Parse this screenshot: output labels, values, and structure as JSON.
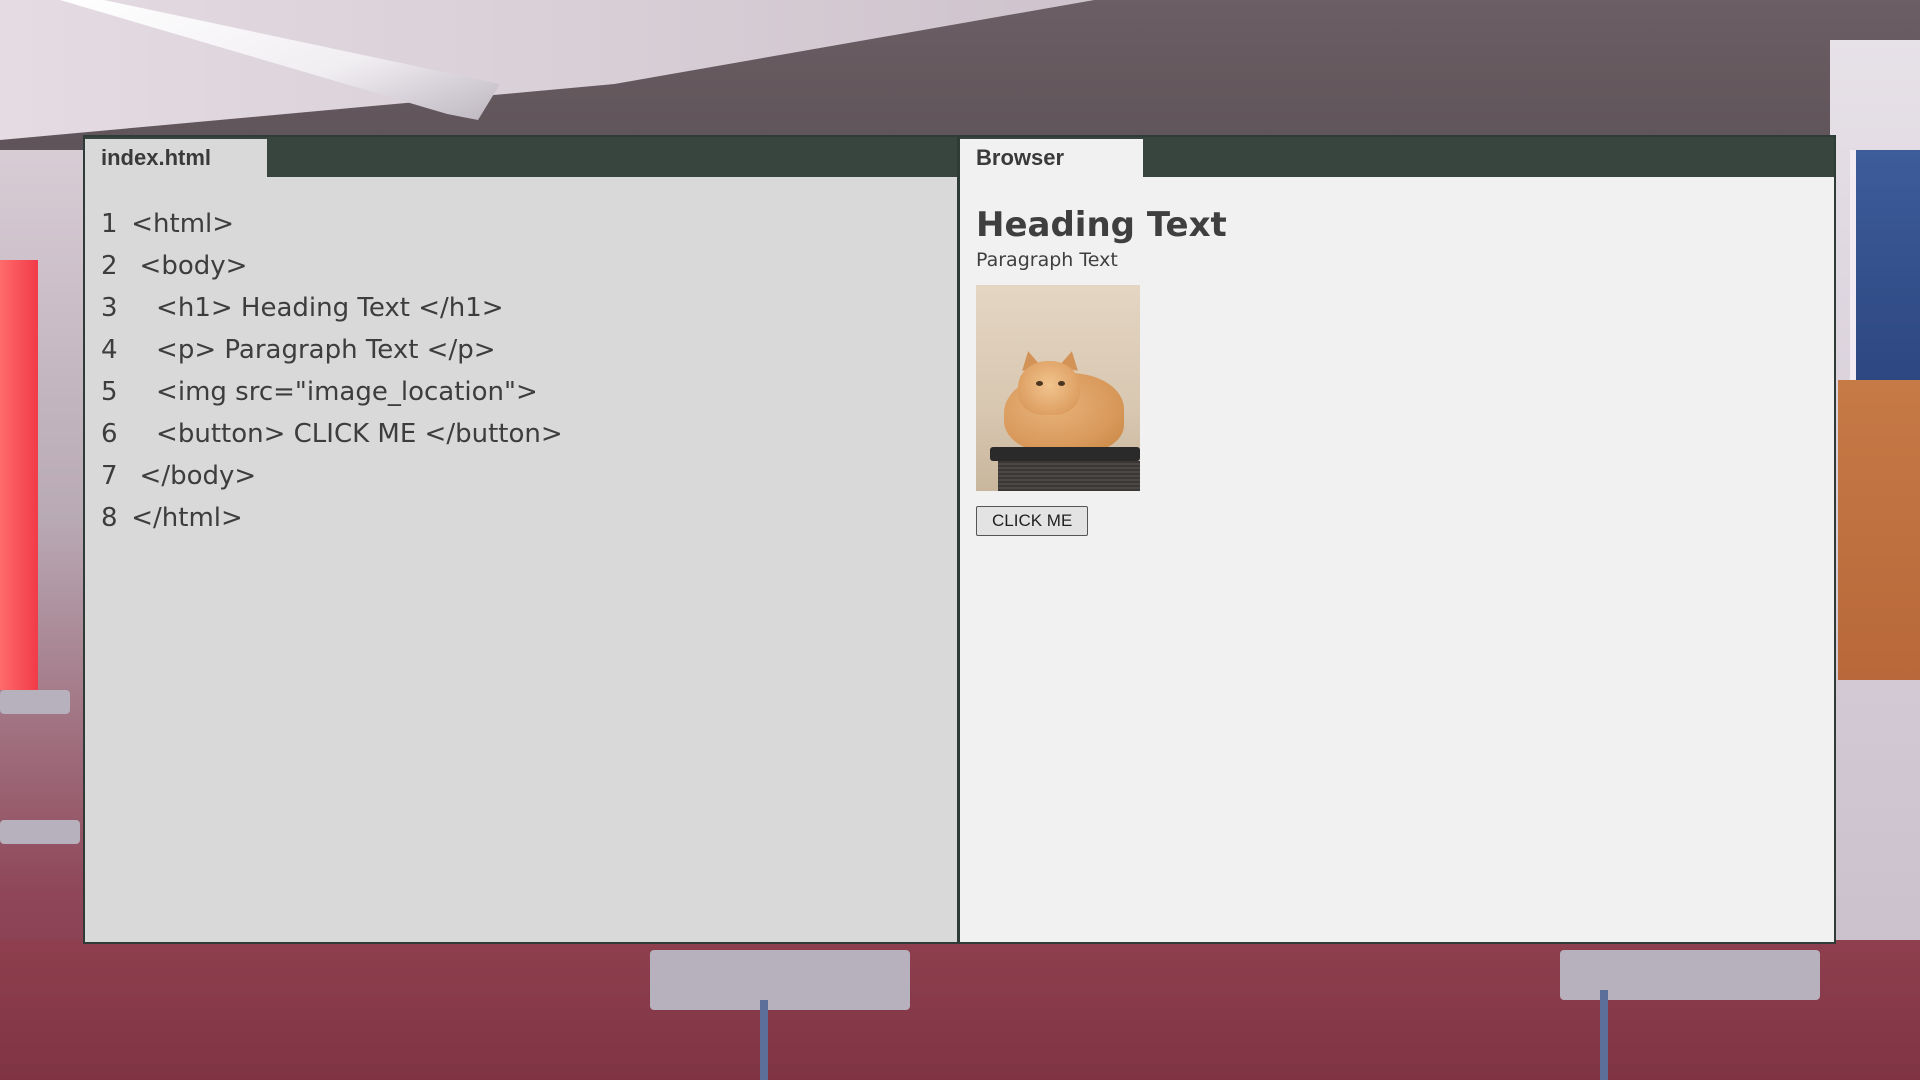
{
  "editor": {
    "tab_label": "index.html",
    "lines": [
      {
        "num": "1",
        "text": " <html>"
      },
      {
        "num": "2",
        "text": "  <body>"
      },
      {
        "num": "3",
        "text": "    <h1> Heading Text </h1>"
      },
      {
        "num": "4",
        "text": "    <p> Paragraph Text </p>"
      },
      {
        "num": "5",
        "text": "    <img src=\"image_location\">"
      },
      {
        "num": "6",
        "text": "    <button> CLICK ME </button>"
      },
      {
        "num": "7",
        "text": "  </body>"
      },
      {
        "num": "8",
        "text": " </html>"
      }
    ]
  },
  "browser": {
    "tab_label": "Browser",
    "heading": "Heading Text",
    "paragraph": "Paragraph Text",
    "image": {
      "icon": "cat-photo"
    },
    "button_label": "CLICK ME"
  },
  "colors": {
    "tabbar": "#38443e",
    "editor_bg": "#d9d9d9",
    "browser_bg": "#f1f1f1",
    "text": "#3d3d3d"
  }
}
